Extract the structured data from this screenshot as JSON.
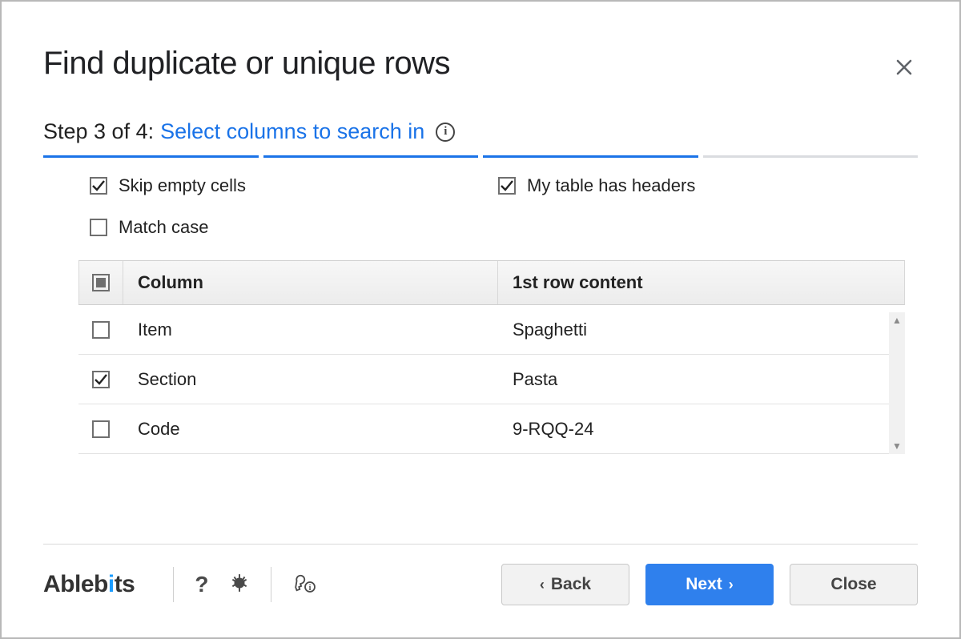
{
  "header": {
    "title": "Find duplicate or unique rows"
  },
  "step": {
    "label": "Step 3 of 4:",
    "description": "Select columns to search in",
    "current": 3,
    "total": 4
  },
  "options": {
    "skip_empty": {
      "label": "Skip empty cells",
      "checked": true
    },
    "has_headers": {
      "label": "My table has headers",
      "checked": true
    },
    "match_case": {
      "label": "Match case",
      "checked": false
    }
  },
  "table": {
    "headers": {
      "column": "Column",
      "content": "1st row content"
    },
    "select_all_state": "indeterminate",
    "rows": [
      {
        "checked": false,
        "column": "Item",
        "content": "Spaghetti"
      },
      {
        "checked": true,
        "column": "Section",
        "content": "Pasta"
      },
      {
        "checked": false,
        "column": "Code",
        "content": "9-RQQ-24"
      }
    ]
  },
  "footer": {
    "brand": "Ablebits",
    "buttons": {
      "back": "Back",
      "next": "Next",
      "close": "Close"
    }
  }
}
